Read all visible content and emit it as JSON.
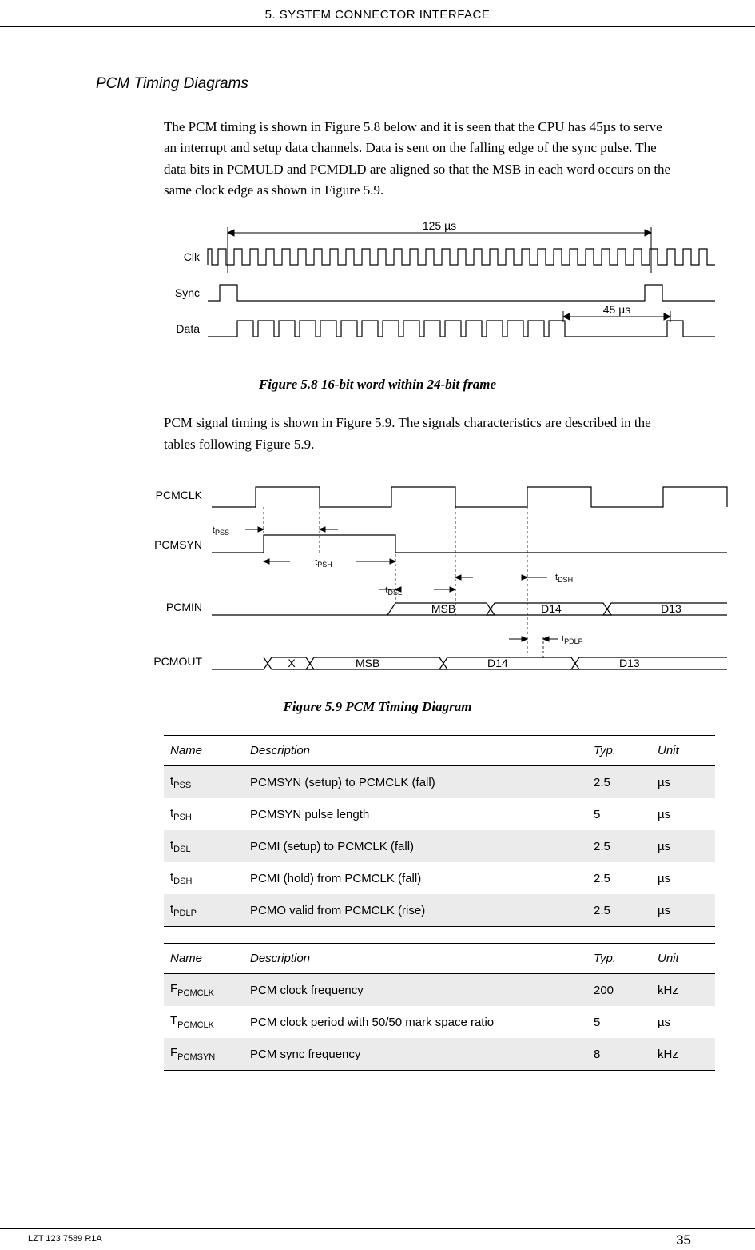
{
  "header": "5. SYSTEM CONNECTOR INTERFACE",
  "section_title": "PCM Timing Diagrams",
  "para1": "The PCM timing is shown in Figure 5.8 below and it is seen that the CPU has 45µs to serve an interrupt and setup data channels. Data is sent on the falling edge of the sync pulse. The data bits in PCMULD and PCMDLD are aligned so that the MSB in each word occurs on the same clock edge as shown in Figure 5.9.",
  "figure1": {
    "caption": "Figure 5.8  16-bit word within 24-bit frame",
    "labels": {
      "clk": "Clk",
      "sync": "Sync",
      "data": "Data",
      "period": "125 µs",
      "gap": "45 µs"
    }
  },
  "para2": "PCM signal timing is shown in Figure 5.9. The signals characteristics are described in the tables following Figure 5.9.",
  "figure2": {
    "caption": "Figure 5.9  PCM Timing Diagram",
    "labels": {
      "pcmclk": "PCMCLK",
      "pcmsyn": "PCMSYN",
      "pcmin": "PCMIN",
      "pcmout": "PCMOUT",
      "tpss": "t",
      "tpss_sub": "PSS",
      "tpsh": "t",
      "tpsh_sub": "PSH",
      "tdsl": "t",
      "tdsl_sub": "DSL",
      "tdsh": "t",
      "tdsh_sub": "DSH",
      "tpdlp": "t",
      "tpdlp_sub": "PDLP",
      "msb": "MSB",
      "d14": "D14",
      "d13": "D13",
      "x": "X"
    }
  },
  "table1": {
    "headers": [
      "Name",
      "Description",
      "Typ.",
      "Unit"
    ],
    "rows": [
      {
        "name_prefix": "t",
        "name_sub": "PSS",
        "desc": "PCMSYN (setup) to PCMCLK (fall)",
        "typ": "2.5",
        "unit": "µs"
      },
      {
        "name_prefix": "t",
        "name_sub": "PSH",
        "desc": "PCMSYN pulse length",
        "typ": "5",
        "unit": "µs"
      },
      {
        "name_prefix": "t",
        "name_sub": "DSL",
        "desc": "PCMI (setup) to PCMCLK (fall)",
        "typ": "2.5",
        "unit": "µs"
      },
      {
        "name_prefix": "t",
        "name_sub": "DSH",
        "desc": "PCMI (hold) from PCMCLK (fall)",
        "typ": "2.5",
        "unit": "µs"
      },
      {
        "name_prefix": "t",
        "name_sub": "PDLP",
        "desc": "PCMO valid from PCMCLK (rise)",
        "typ": "2.5",
        "unit": "µs"
      }
    ]
  },
  "table2": {
    "headers": [
      "Name",
      "Description",
      "Typ.",
      "Unit"
    ],
    "rows": [
      {
        "name_prefix": "F",
        "name_sub": "PCMCLK",
        "desc": "PCM clock frequency",
        "typ": "200",
        "unit": "kHz"
      },
      {
        "name_prefix": "T",
        "name_sub": "PCMCLK",
        "desc": "PCM clock period with 50/50 mark space ratio",
        "typ": "5",
        "unit": "µs"
      },
      {
        "name_prefix": "F",
        "name_sub": "PCMSYN",
        "desc": "PCM sync frequency",
        "typ": "8",
        "unit": "kHz"
      }
    ]
  },
  "footer": {
    "left": "LZT 123 7589 R1A",
    "right": "35"
  }
}
